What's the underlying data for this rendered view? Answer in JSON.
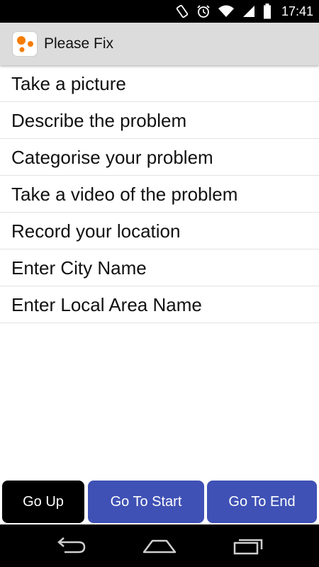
{
  "status_bar": {
    "time": "17:41",
    "icons": [
      "rotate-icon",
      "alarm-icon",
      "wifi-icon",
      "signal-icon",
      "battery-icon"
    ]
  },
  "app_bar": {
    "title": "Please Fix",
    "icon": "app-logo-icon",
    "accent": "#f57c00"
  },
  "menu": {
    "items": [
      {
        "label": "Take a picture"
      },
      {
        "label": "Describe the problem"
      },
      {
        "label": "Categorise your problem"
      },
      {
        "label": "Take a video of the problem"
      },
      {
        "label": "Record your location"
      },
      {
        "label": "Enter City Name"
      },
      {
        "label": "Enter Local Area Name"
      }
    ]
  },
  "buttons": {
    "go_up": "Go Up",
    "go_to_start": "Go To Start",
    "go_to_end": "Go To End",
    "primary_color": "#3f51b5",
    "go_up_color": "#000000"
  },
  "nav_bar": {
    "icons": [
      "back-icon",
      "home-icon",
      "recent-apps-icon"
    ]
  }
}
